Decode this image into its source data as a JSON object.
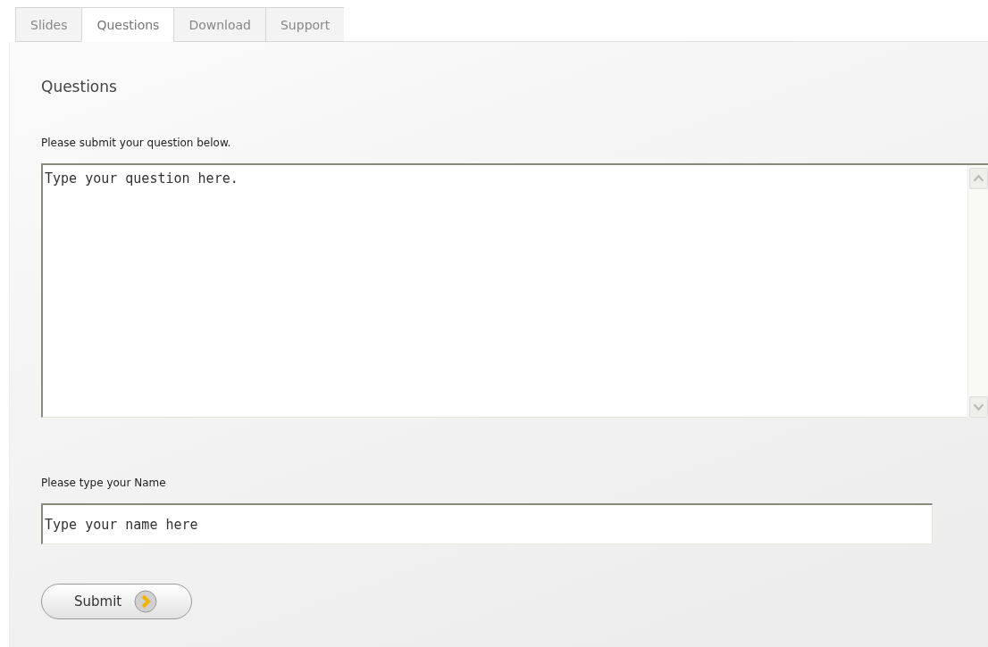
{
  "tabs": [
    {
      "label": "Slides",
      "selected": false
    },
    {
      "label": "Questions",
      "selected": true
    },
    {
      "label": "Download",
      "selected": false
    },
    {
      "label": "Support",
      "selected": false
    }
  ],
  "heading": "Questions",
  "question": {
    "label": "Please submit your question below.",
    "value": "Type your question here."
  },
  "name": {
    "label": "Please type your Name",
    "value": "Type your name here"
  },
  "submit_button": "Submit"
}
